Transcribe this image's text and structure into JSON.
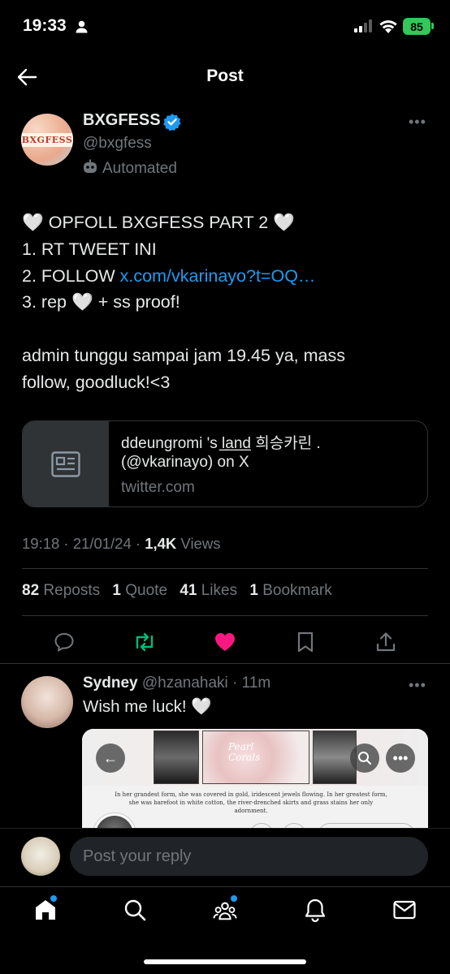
{
  "status_bar": {
    "time": "19:33",
    "battery": "85"
  },
  "header": {
    "title": "Post"
  },
  "post": {
    "author_name": "BXGFESS",
    "avatar_text": "BXGFESS",
    "handle": "@bxgfess",
    "automated_label": "Automated",
    "lines": {
      "l1": "🤍 OPFOLL BXGFESS PART 2 🤍",
      "l2": "1. RT TWEET INI",
      "l3_prefix": "2. FOLLOW ",
      "l3_link": "x.com/vkarinayo?t=OQ…",
      "l4": "3. rep 🤍 + ss proof!",
      "l5": "admin tunggu sampai jam 19.45 ya, mass",
      "l6": "follow, goodluck!<3"
    },
    "card": {
      "title_line1": "ddeungromi 's l̲a̲n̲d̲ 희승카린 .",
      "title_line2": "(@vkarinayo) on X",
      "domain": "twitter.com"
    },
    "meta": {
      "time": "19:18",
      "sep1": " · ",
      "date": "21/01/24",
      "sep2": " · ",
      "views_count": "1,4K",
      "views_label": " Views"
    },
    "stats": {
      "reposts_count": "82",
      "reposts_label": " Reposts",
      "quote_count": "1",
      "quote_label": " Quote",
      "likes_count": "41",
      "likes_label": " Likes",
      "bookmark_count": "1",
      "bookmark_label": " Bookmark"
    }
  },
  "reply": {
    "name": "Sydney",
    "handle": " @hzanahaki",
    "time": " · 11m",
    "text": "Wish me luck! 🤍",
    "media_caption": "In her grandest form, she was covered in gold, iridescent jewels flowing. In her greatest form, she was barefoot in white cotton, the river-drenched skirts and grass stains her only adornment.",
    "media_overlay_text": "Pearl\nCorals"
  },
  "compose": {
    "placeholder": "Post your reply"
  },
  "colors": {
    "accent": "#1d9bf0",
    "repost_active": "#00ba7c",
    "like_active": "#f91880",
    "battery": "#34c759"
  },
  "icons": {
    "back": "arrow-left-icon",
    "verified": "verified-badge-icon",
    "automated": "robot-icon",
    "reply": "comment-icon",
    "repost": "repost-icon",
    "like": "heart-filled-icon",
    "bookmark": "bookmark-icon",
    "share": "share-icon",
    "nav": [
      "home-icon",
      "search-icon",
      "communities-icon",
      "notifications-icon",
      "messages-icon"
    ]
  }
}
